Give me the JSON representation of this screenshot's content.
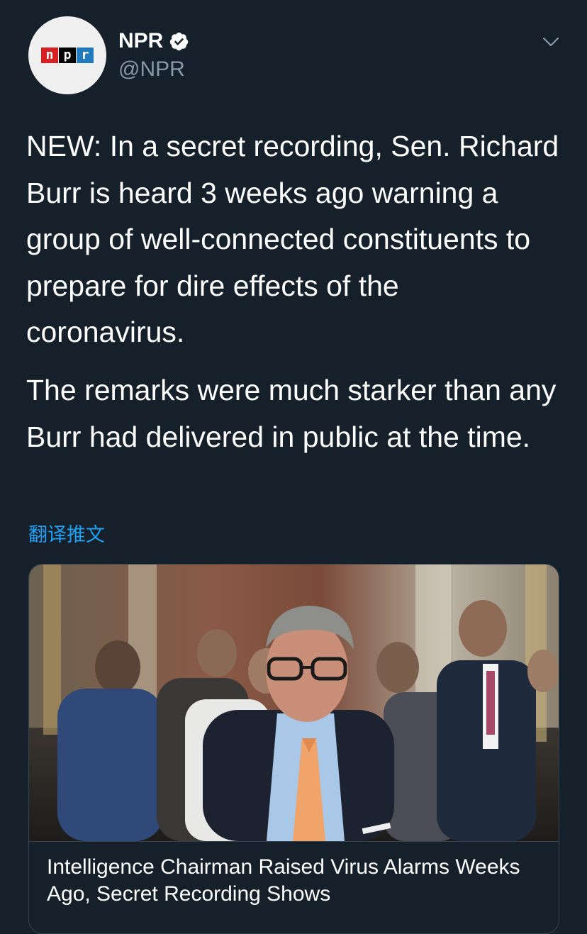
{
  "author": {
    "display_name": "NPR",
    "handle": "@NPR",
    "logo_letters": [
      "n",
      "p",
      "r"
    ],
    "logo_colors": [
      "#d62021",
      "#000000",
      "#237bbd"
    ]
  },
  "tweet": {
    "paragraphs": [
      "NEW: In a secret recording, Sen. Richard Burr is heard 3 weeks ago warning a group of well-connected constituents to prepare for dire effects of the coronavirus.",
      "The remarks were much starker than any Burr had delivered in public at the time."
    ],
    "translate_label": "翻译推文"
  },
  "card": {
    "title": "Intelligence Chairman Raised Virus Alarms Weeks Ago, Secret Recording Shows",
    "image_alt": "photo-of-richard-burr"
  },
  "colors": {
    "background": "#15202b",
    "text": "#ffffff",
    "secondary": "#8899a6",
    "link": "#1da1f2",
    "border": "#38444d"
  },
  "icons": {
    "verified": "verified-badge-icon",
    "more": "chevron-down-icon"
  }
}
